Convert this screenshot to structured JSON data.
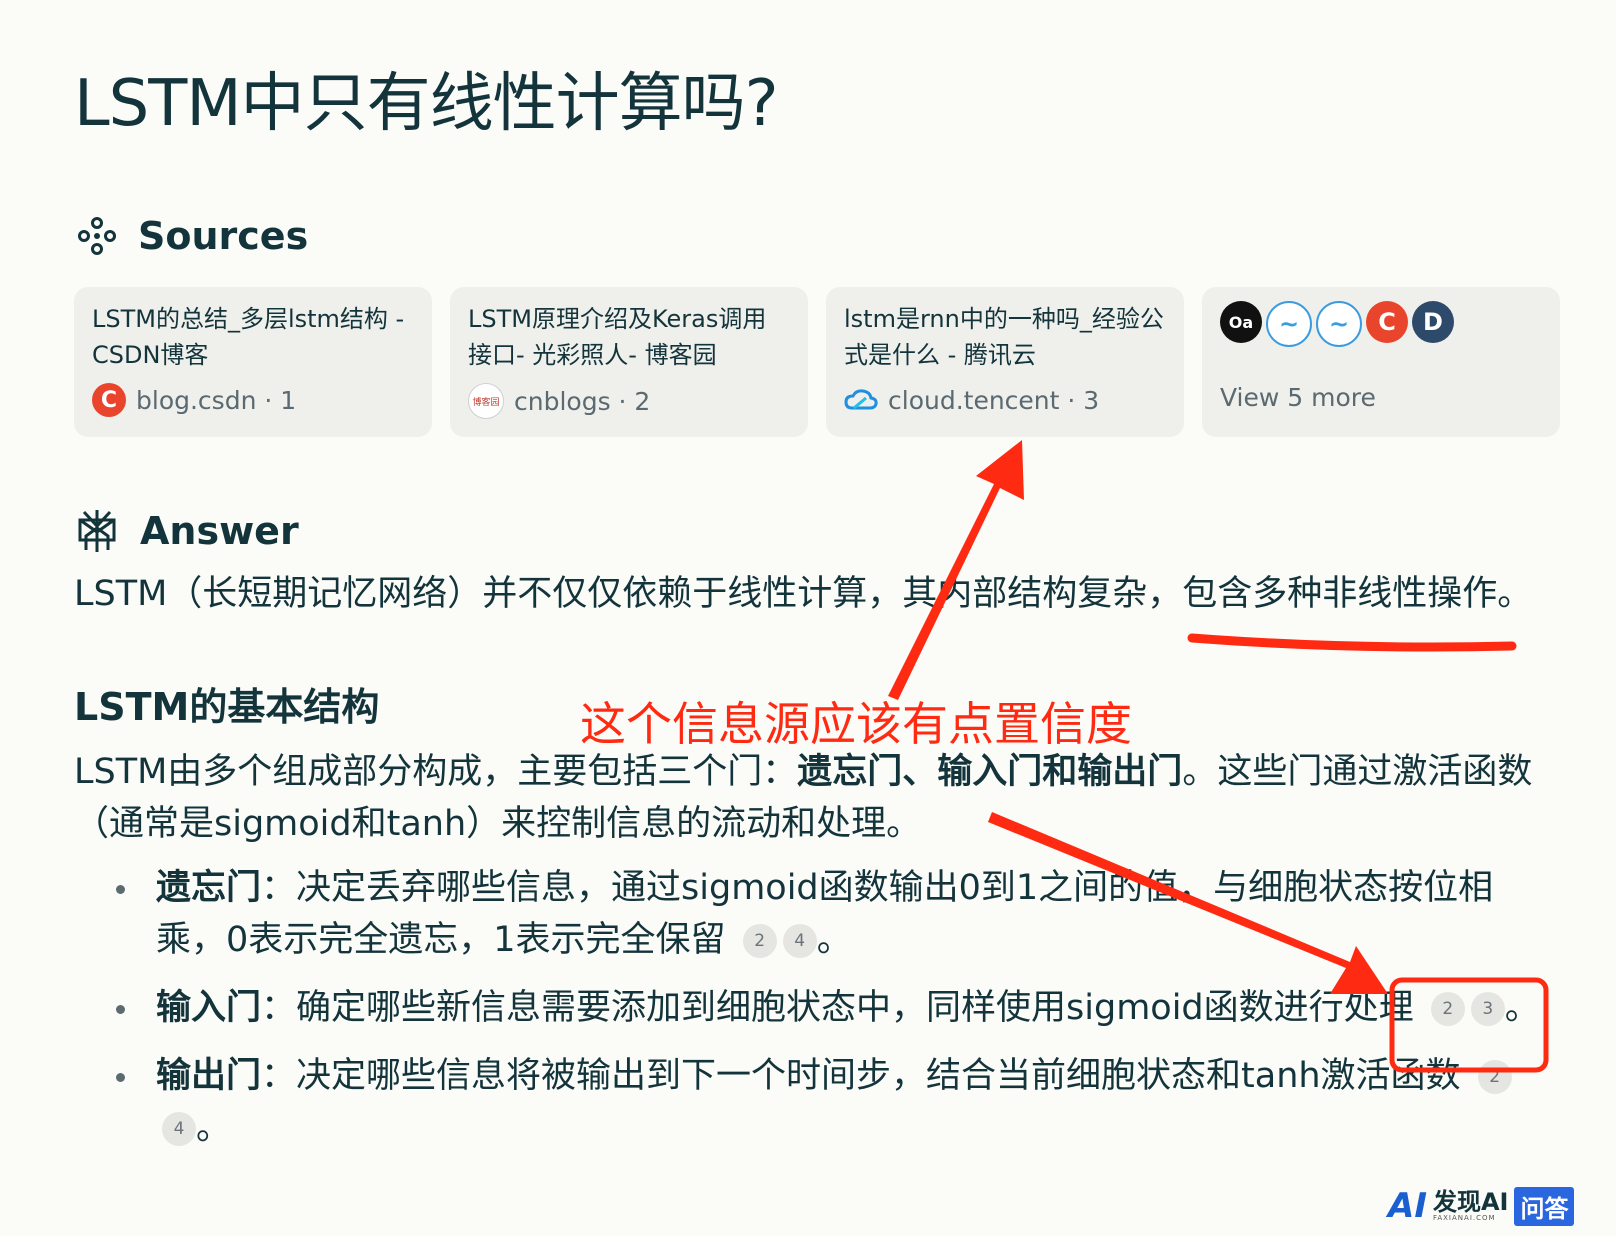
{
  "page": {
    "title": "LSTM中只有线性计算吗?"
  },
  "sources": {
    "heading": "Sources",
    "cards": [
      {
        "title": "LSTM的总结_多层lstm结构 - CSDN博客",
        "site": "blog.csdn · 1",
        "icon": "csdn-icon",
        "icon_glyph": "C"
      },
      {
        "title": "LSTM原理介绍及Keras调用接口- 光彩照人- 博客园",
        "site": "cnblogs · 2",
        "icon": "cnblogs-icon",
        "icon_glyph": "博客园"
      },
      {
        "title": "lstm是rnn中的一种吗_经验公式是什么 - 腾讯云",
        "site": "cloud.tencent · 3",
        "icon": "tencent-cloud-icon"
      }
    ],
    "more": {
      "label": "View 5 more",
      "icons": [
        "oa-icon",
        "wave-icon",
        "wave-icon",
        "csdn-icon",
        "d-icon"
      ],
      "glyphs": [
        "Oa",
        "",
        "",
        "C",
        "D"
      ]
    }
  },
  "answer": {
    "heading": "Answer",
    "intro": "LSTM（长短期记忆网络）并不仅仅依赖于线性计算，其内部结构复杂，包含多种非线性操作。",
    "section_title": "LSTM的基本结构",
    "structure_pre": "LSTM由多个组成部分构成，主要包括三个门：",
    "structure_bold": "遗忘门、输入门和输出门",
    "structure_post": "。这些门通过激活函数（通常是sigmoid和tanh）来控制信息的流动和处理。",
    "bullets": [
      {
        "term": "遗忘门",
        "text": "：决定丢弃哪些信息，通过sigmoid函数输出0到1之间的值，与细胞状态按位相乘，0表示完全遗忘，1表示完全保留",
        "cites": [
          "2",
          "4"
        ],
        "end": "。"
      },
      {
        "term": "输入门",
        "text": "：确定哪些新信息需要添加到细胞状态中，同样使用sigmoid函数进行处理",
        "cites": [
          "2",
          "3"
        ],
        "end": "。"
      },
      {
        "term": "输出门",
        "text": "：决定哪些信息将被输出到下一个时间步，结合当前细胞状态和tanh激活函数",
        "cites": [
          "2",
          "4"
        ],
        "end": "。"
      }
    ]
  },
  "annotation": {
    "text": "这个信息源应该有点置信度",
    "color": "#ff2a12"
  },
  "watermark": {
    "brand": "发现AI",
    "sub": "FAXIANAI.COM",
    "box": "问答"
  },
  "colors": {
    "text": "#13343b",
    "card_bg": "#efefec",
    "annotation": "#ff2a12"
  }
}
